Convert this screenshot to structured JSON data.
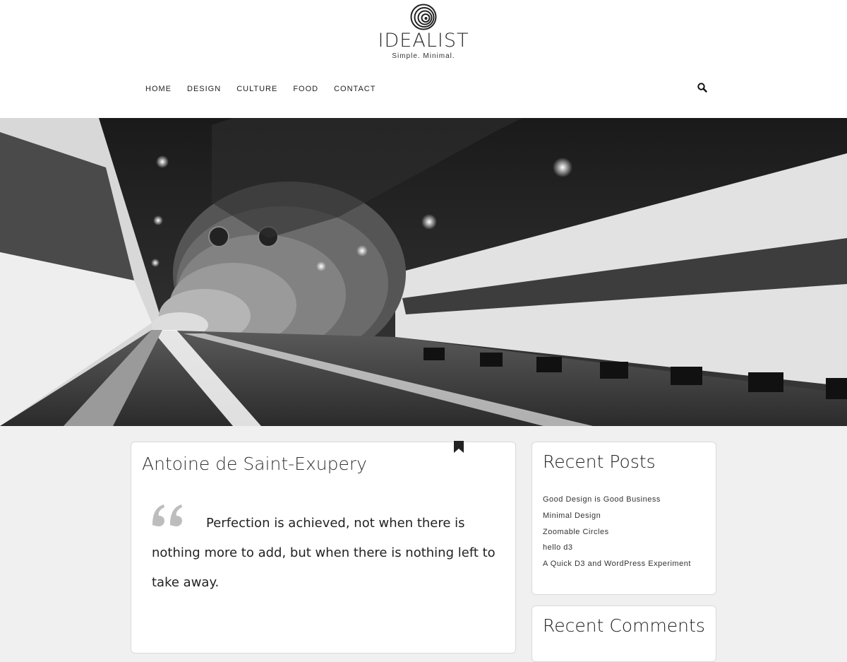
{
  "site": {
    "title": "IDEALIST",
    "tagline": "Simple. Minimal."
  },
  "nav": {
    "items": [
      "HOME",
      "DESIGN",
      "CULTURE",
      "FOOD",
      "CONTACT"
    ],
    "search_icon": "search-icon"
  },
  "hero": {
    "image": "tunnel-photo"
  },
  "post": {
    "title": "Antoine de Saint-Exupery",
    "quote": "Perfection is achieved, not when there is nothing more to add, but when there is nothing left to take away.",
    "bookmark_icon": "bookmark-icon",
    "quote_icon": "quote-icon"
  },
  "sidebar": {
    "recent_posts": {
      "title": "Recent Posts",
      "items": [
        "Good Design is Good Business",
        "Minimal Design",
        "Zoomable Circles",
        "hello d3",
        "A Quick D3 and WordPress Experiment"
      ]
    },
    "recent_comments": {
      "title": "Recent Comments"
    }
  },
  "colors": {
    "page_background": "#f0f0f0",
    "header_background": "#ffffff",
    "text": "#222222"
  }
}
